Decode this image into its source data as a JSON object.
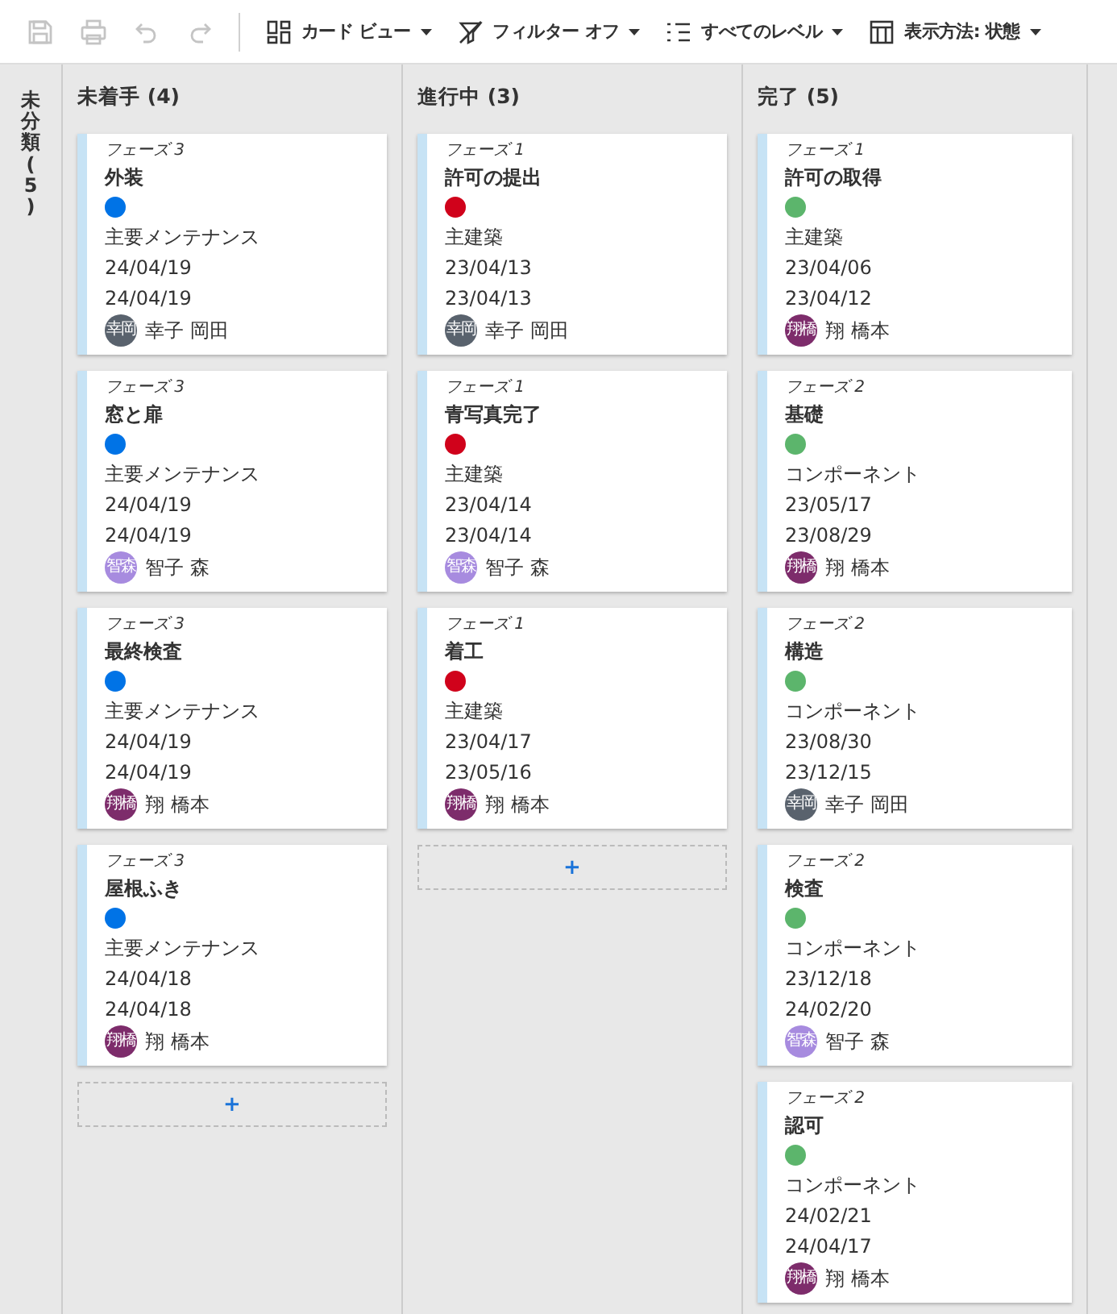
{
  "toolbar": {
    "icon_buttons": [
      {
        "kind": "save",
        "disabled": true
      },
      {
        "kind": "print",
        "disabled": true
      },
      {
        "kind": "undo",
        "disabled": true
      },
      {
        "kind": "redo",
        "disabled": true
      }
    ],
    "menus": [
      {
        "kind": "grid",
        "label": "カード ビュー"
      },
      {
        "kind": "filter-off",
        "label": "フィルター オフ"
      },
      {
        "kind": "list",
        "label": "すべてのレベル"
      },
      {
        "kind": "table",
        "label": "表示方法: 状態"
      }
    ]
  },
  "unclassified": {
    "label": "未分類 (5)"
  },
  "columns": [
    {
      "title": "未着手 (4)",
      "add": "+",
      "cards": [
        {
          "phase": "フェーズ 3",
          "title": "外装",
          "color": "#0073e6",
          "category": "主要メンテナンス",
          "start": "24/04/19",
          "end": "24/04/19",
          "assignee": {
            "initials": "幸岡",
            "color": "#59626d",
            "name": "幸子 岡田"
          }
        },
        {
          "phase": "フェーズ 3",
          "title": "窓と扉",
          "color": "#0073e6",
          "category": "主要メンテナンス",
          "start": "24/04/19",
          "end": "24/04/19",
          "assignee": {
            "initials": "智森",
            "color": "#a78bdf",
            "name": "智子 森"
          }
        },
        {
          "phase": "フェーズ 3",
          "title": "最終検査",
          "color": "#0073e6",
          "category": "主要メンテナンス",
          "start": "24/04/19",
          "end": "24/04/19",
          "assignee": {
            "initials": "翔橋",
            "color": "#7d2c6b",
            "name": "翔 橋本"
          }
        },
        {
          "phase": "フェーズ 3",
          "title": "屋根ふき",
          "color": "#0073e6",
          "category": "主要メンテナンス",
          "start": "24/04/18",
          "end": "24/04/18",
          "assignee": {
            "initials": "翔橋",
            "color": "#7d2c6b",
            "name": "翔 橋本"
          }
        }
      ]
    },
    {
      "title": "進行中 (3)",
      "add": "+",
      "cards": [
        {
          "phase": "フェーズ 1",
          "title": "許可の提出",
          "color": "#d0021b",
          "category": "主建築",
          "start": "23/04/13",
          "end": "23/04/13",
          "assignee": {
            "initials": "幸岡",
            "color": "#59626d",
            "name": "幸子 岡田"
          }
        },
        {
          "phase": "フェーズ 1",
          "title": "青写真完了",
          "color": "#d0021b",
          "category": "主建築",
          "start": "23/04/14",
          "end": "23/04/14",
          "assignee": {
            "initials": "智森",
            "color": "#a78bdf",
            "name": "智子 森"
          }
        },
        {
          "phase": "フェーズ 1",
          "title": "着工",
          "color": "#d0021b",
          "category": "主建築",
          "start": "23/04/17",
          "end": "23/05/16",
          "assignee": {
            "initials": "翔橋",
            "color": "#7d2c6b",
            "name": "翔 橋本"
          }
        }
      ]
    },
    {
      "title": "完了 (5)",
      "cards": [
        {
          "phase": "フェーズ 1",
          "title": "許可の取得",
          "color": "#5cb56c",
          "category": "主建築",
          "start": "23/04/06",
          "end": "23/04/12",
          "assignee": {
            "initials": "翔橋",
            "color": "#7d2c6b",
            "name": "翔 橋本"
          }
        },
        {
          "phase": "フェーズ 2",
          "title": "基礎",
          "color": "#5cb56c",
          "category": "コンポーネント",
          "start": "23/05/17",
          "end": "23/08/29",
          "assignee": {
            "initials": "翔橋",
            "color": "#7d2c6b",
            "name": "翔 橋本"
          }
        },
        {
          "phase": "フェーズ 2",
          "title": "構造",
          "color": "#5cb56c",
          "category": "コンポーネント",
          "start": "23/08/30",
          "end": "23/12/15",
          "assignee": {
            "initials": "幸岡",
            "color": "#59626d",
            "name": "幸子 岡田"
          }
        },
        {
          "phase": "フェーズ 2",
          "title": "検査",
          "color": "#5cb56c",
          "category": "コンポーネント",
          "start": "23/12/18",
          "end": "24/02/20",
          "assignee": {
            "initials": "智森",
            "color": "#a78bdf",
            "name": "智子 森"
          }
        },
        {
          "phase": "フェーズ 2",
          "title": "認可",
          "color": "#5cb56c",
          "category": "コンポーネント",
          "start": "24/02/21",
          "end": "24/04/17",
          "assignee": {
            "initials": "翔橋",
            "color": "#7d2c6b",
            "name": "翔 橋本"
          }
        }
      ]
    }
  ]
}
